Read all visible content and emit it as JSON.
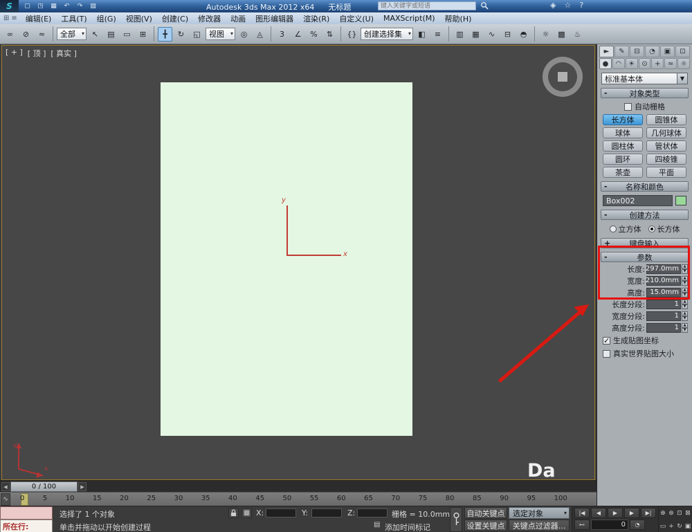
{
  "colors": {
    "annotation_red": "#e8120f",
    "object_fill": "#e4f7e2",
    "active_button_blue": "#3e96d6",
    "name_swatch_green": "#9ad89a"
  },
  "title_bar": {
    "logo_text": "S",
    "quick_access": [
      {
        "name": "new-scene-icon",
        "text": "▢"
      },
      {
        "name": "open-file-icon",
        "text": "◳"
      },
      {
        "name": "save-file-icon",
        "text": "▦"
      },
      {
        "name": "undo-icon",
        "text": "↶"
      },
      {
        "name": "redo-icon",
        "text": "↷"
      },
      {
        "name": "project-folder-icon",
        "text": "▧"
      }
    ],
    "title": "Autodesk 3ds Max 2012 x64",
    "doc_title": "无标题",
    "search_placeholder": "键入关键字或短语",
    "info_icons": [
      {
        "name": "communication-center-icon",
        "text": "◈"
      },
      {
        "name": "favorites-icon",
        "text": "☆"
      },
      {
        "name": "help-icon",
        "text": "?"
      }
    ]
  },
  "menu_bar": {
    "left_icons": [
      {
        "name": "window-layout-icon",
        "text": "⊞"
      },
      {
        "name": "scene-explorer-icon",
        "text": "≡"
      }
    ],
    "items": [
      "编辑(E)",
      "工具(T)",
      "组(G)",
      "视图(V)",
      "创建(C)",
      "修改器",
      "动画",
      "图形编辑器",
      "渲染(R)",
      "自定义(U)",
      "MAXScript(M)",
      "帮助(H)"
    ]
  },
  "toolbar": {
    "items": [
      {
        "type": "icon",
        "name": "select-and-link-icon",
        "text": "∞"
      },
      {
        "type": "icon",
        "name": "unlink-selection-icon",
        "text": "⊘"
      },
      {
        "type": "icon",
        "name": "bind-to-spacewarp-icon",
        "text": "≈"
      },
      {
        "type": "sep",
        "name": "toolbar-separator",
        "text": ""
      },
      {
        "type": "dd",
        "name": "selection-filter-dropdown",
        "text": "全部"
      },
      {
        "type": "icon",
        "name": "select-object-icon",
        "text": "↖"
      },
      {
        "type": "icon",
        "name": "select-by-name-icon",
        "text": "▤"
      },
      {
        "type": "icon",
        "name": "rect-selection-region-icon",
        "text": "▭"
      },
      {
        "type": "icon",
        "name": "window-crossing-icon",
        "text": "⊞"
      },
      {
        "type": "sep",
        "name": "toolbar-separator",
        "text": ""
      },
      {
        "type": "icon",
        "name": "select-and-move-icon",
        "text": "╋",
        "active": true
      },
      {
        "type": "icon",
        "name": "select-and-rotate-icon",
        "text": "↻"
      },
      {
        "type": "icon",
        "name": "select-and-scale-icon",
        "text": "◱"
      },
      {
        "type": "dd",
        "name": "reference-coord-dropdown",
        "text": "视图"
      },
      {
        "type": "icon",
        "name": "use-pivot-center-icon",
        "text": "◎"
      },
      {
        "type": "icon",
        "name": "select-and-manipulate-icon",
        "text": "◬"
      },
      {
        "type": "sep",
        "name": "toolbar-separator",
        "text": ""
      },
      {
        "type": "icon",
        "name": "snap-toggle-3d-icon",
        "text": "3"
      },
      {
        "type": "icon",
        "name": "angle-snap-icon",
        "text": "∠"
      },
      {
        "type": "icon",
        "name": "percent-snap-icon",
        "text": "%"
      },
      {
        "type": "icon",
        "name": "spinner-snap-icon",
        "text": "⇅"
      },
      {
        "type": "sep",
        "name": "toolbar-separator",
        "text": ""
      },
      {
        "type": "icon",
        "name": "named-selection-sets-icon",
        "text": "{}"
      },
      {
        "type": "dd",
        "name": "named-selection-dropdown",
        "text": "创建选择集"
      },
      {
        "type": "icon",
        "name": "mirror-icon",
        "text": "◧"
      },
      {
        "type": "icon",
        "name": "align-icon",
        "text": "≡"
      },
      {
        "type": "sep",
        "name": "toolbar-separator",
        "text": ""
      },
      {
        "type": "icon",
        "name": "layer-manager-icon",
        "text": "▥"
      },
      {
        "type": "icon",
        "name": "graphite-ribbon-icon",
        "text": "▦"
      },
      {
        "type": "icon",
        "name": "curve-editor-icon",
        "text": "∿"
      },
      {
        "type": "icon",
        "name": "schematic-view-icon",
        "text": "⊟"
      },
      {
        "type": "icon",
        "name": "material-editor-icon",
        "text": "◓"
      },
      {
        "type": "sep",
        "name": "toolbar-separator",
        "text": ""
      },
      {
        "type": "icon",
        "name": "render-setup-icon",
        "text": "☼"
      },
      {
        "type": "icon",
        "name": "rendered-frame-icon",
        "text": "▩"
      },
      {
        "type": "icon",
        "name": "render-production-icon",
        "text": "♨"
      }
    ]
  },
  "viewport": {
    "label_general": "[ + ]",
    "label_view": "[ 顶 ]",
    "label_shading": "[ 真实 ]",
    "axis_x": "x",
    "axis_y": "y",
    "tripod_x": "x",
    "tripod_y": "y",
    "watermark": "Da"
  },
  "command_panel": {
    "tabs": [
      {
        "name": "tab-create",
        "text": "►",
        "active": true
      },
      {
        "name": "tab-modify",
        "text": "✎"
      },
      {
        "name": "tab-hierarchy",
        "text": "⊟"
      },
      {
        "name": "tab-motion",
        "text": "◔"
      },
      {
        "name": "tab-display",
        "text": "▣"
      },
      {
        "name": "tab-utilities",
        "text": "⊡"
      }
    ],
    "categories": [
      {
        "name": "category-geometry",
        "text": "●",
        "active": true
      },
      {
        "name": "category-shapes",
        "text": "◠"
      },
      {
        "name": "category-lights",
        "text": "☀"
      },
      {
        "name": "category-cameras",
        "text": "⊙"
      },
      {
        "name": "category-helpers",
        "text": "+"
      },
      {
        "name": "category-spacewarps",
        "text": "≈"
      },
      {
        "name": "category-systems",
        "text": "☼"
      }
    ],
    "primitive_dropdown": "标准基本体",
    "object_type": {
      "state": "-",
      "title": "对象类型",
      "autogrid_label": "自动栅格",
      "autogrid_checked": false,
      "buttons": [
        {
          "name": "button-box",
          "label": "长方体",
          "active": true
        },
        {
          "name": "button-cone",
          "label": "圆锥体"
        },
        {
          "name": "button-sphere",
          "label": "球体"
        },
        {
          "name": "button-geosphere",
          "label": "几何球体"
        },
        {
          "name": "button-cylinder",
          "label": "圆柱体"
        },
        {
          "name": "button-tube",
          "label": "管状体"
        },
        {
          "name": "button-torus",
          "label": "圆环"
        },
        {
          "name": "button-pyramid",
          "label": "四棱锥"
        },
        {
          "name": "button-teapot",
          "label": "茶壶"
        },
        {
          "name": "button-plane",
          "label": "平面"
        }
      ]
    },
    "name_color": {
      "state": "-",
      "title": "名称和颜色",
      "object_name": "Box002",
      "swatch": "#9ad89a"
    },
    "creation_method": {
      "state": "-",
      "title": "创建方法",
      "options": [
        {
          "name": "radio-cube",
          "text": "立方体",
          "checked": false
        },
        {
          "name": "radio-box",
          "text": "长方体",
          "checked": true
        }
      ]
    },
    "keyboard_entry": {
      "state": "+",
      "title": "键盘输入"
    },
    "parameters": {
      "state": "-",
      "title": "参数",
      "dims": [
        {
          "name": "length-field",
          "label": "长度:",
          "value": "297.0mm"
        },
        {
          "name": "width-field",
          "label": "宽度:",
          "value": "210.0mm"
        },
        {
          "name": "height-field",
          "label": "高度:",
          "value": "15.0mm"
        }
      ],
      "segs": [
        {
          "name": "length-segs-field",
          "label": "长度分段:",
          "value": "1"
        },
        {
          "name": "width-segs-field",
          "label": "宽度分段:",
          "value": "1"
        },
        {
          "name": "height-segs-field",
          "label": "高度分段:",
          "value": "1"
        }
      ],
      "checks": [
        {
          "name": "generate-mapping-coords-checkbox",
          "label": "生成贴图坐标",
          "checked": true
        },
        {
          "name": "real-world-map-size-checkbox",
          "label": "真实世界贴图大小",
          "checked": false
        }
      ]
    }
  },
  "timeline": {
    "slider_value": "0 / 100",
    "ticks": [
      "0",
      "5",
      "10",
      "15",
      "20",
      "25",
      "30",
      "35",
      "40",
      "45",
      "50",
      "55",
      "60",
      "65",
      "70",
      "75",
      "80",
      "85",
      "90",
      "95",
      "100"
    ]
  },
  "status_bar": {
    "listener_label": "所在行:",
    "selection_status": "选择了 1 个对象",
    "prompt": "单击并拖动以开始创建过程",
    "add_time_tag": "添加时间标记",
    "x_label": "X:",
    "y_label": "Y:",
    "z_label": "Z:",
    "x_value": "",
    "y_value": "",
    "z_value": "",
    "grid_status": "栅格 = 10.0mm",
    "auto_key": "自动关键点",
    "set_key": "设置关键点",
    "selected_filter": "选定对象",
    "key_filters": "关键点过滤器..."
  },
  "transport": {
    "row1": [
      {
        "name": "goto-start-button",
        "text": "|◀"
      },
      {
        "name": "prev-frame-button",
        "text": "◀"
      },
      {
        "name": "play-button",
        "text": "▶"
      },
      {
        "name": "next-frame-button",
        "text": "▶"
      },
      {
        "name": "goto-end-button",
        "text": "▶|"
      }
    ],
    "row2": [
      {
        "name": "key-mode-button",
        "text": "⊷"
      },
      {
        "name": "current-frame-field",
        "text": "0",
        "type": "field"
      },
      {
        "name": "time-config-button",
        "text": "◔"
      }
    ]
  },
  "nav": {
    "buttons": [
      {
        "name": "zoom-button",
        "text": "⊕"
      },
      {
        "name": "zoom-all-button",
        "text": "⊛"
      },
      {
        "name": "zoom-extents-button",
        "text": "⊡"
      },
      {
        "name": "zoom-extents-all-button",
        "text": "⊠"
      },
      {
        "name": "zoom-region-button",
        "text": "▭"
      },
      {
        "name": "pan-button",
        "text": "+"
      },
      {
        "name": "orbit-button",
        "text": "↻"
      },
      {
        "name": "maximize-viewport-button",
        "text": "▣"
      }
    ],
    "mini_curve_editor": "∿"
  }
}
